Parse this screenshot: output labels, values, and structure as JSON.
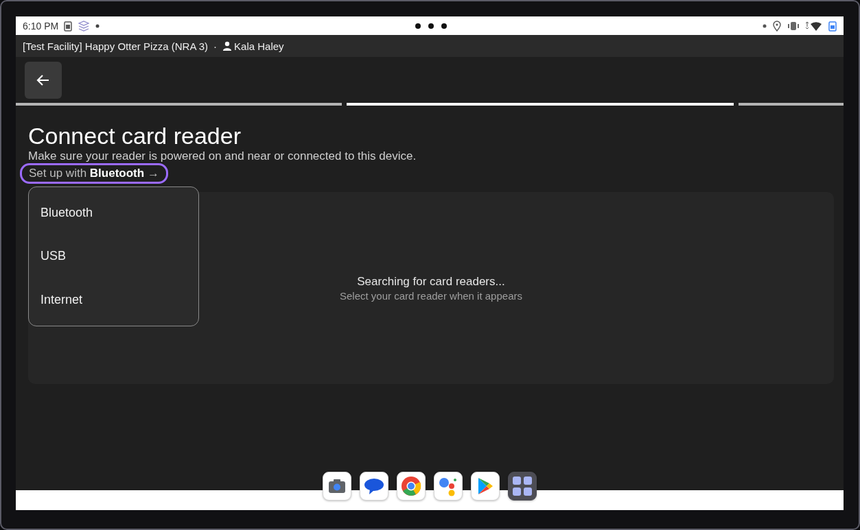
{
  "status_bar": {
    "time": "6:10 PM"
  },
  "header": {
    "facility": "[Test Facility] Happy Otter Pizza (NRA 3)",
    "separator": "·",
    "user": "Kala Haley"
  },
  "steps": [
    {
      "selected": false
    },
    {
      "selected": true
    },
    {
      "selected": false
    }
  ],
  "page": {
    "title": "Connect card reader",
    "subtitle": "Make sure your reader is powered on and near or connected to this device.",
    "setup_link": "Set up with **Bluetooth** →",
    "highlighted": true
  },
  "menu": {
    "items": [
      "Bluetooth",
      "USB",
      "Internet"
    ]
  },
  "status": {
    "title": "Searching for card readers...",
    "hint": "Select your card reader when it appears"
  },
  "dock": {
    "apps": [
      {
        "kind": "camera"
      },
      {
        "kind": "messages"
      },
      {
        "kind": "browser"
      },
      {
        "kind": "assistant"
      },
      {
        "kind": "store"
      },
      {
        "kind": "apps"
      }
    ]
  }
}
